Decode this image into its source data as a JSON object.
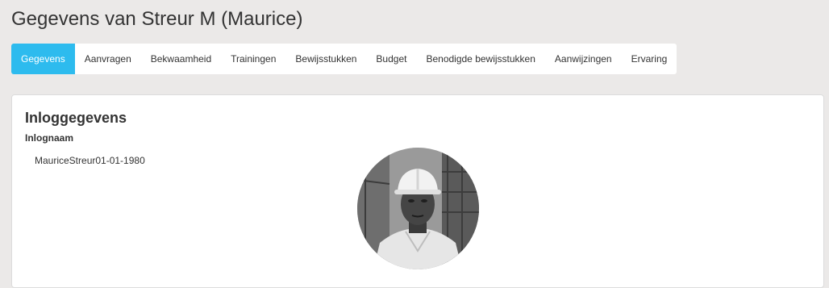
{
  "page": {
    "title": "Gegevens van Streur M (Maurice)"
  },
  "tabs": [
    {
      "label": "Gegevens",
      "active": true
    },
    {
      "label": "Aanvragen",
      "active": false
    },
    {
      "label": "Bekwaamheid",
      "active": false
    },
    {
      "label": "Trainingen",
      "active": false
    },
    {
      "label": "Bewijsstukken",
      "active": false
    },
    {
      "label": "Budget",
      "active": false
    },
    {
      "label": "Benodigde bewijsstukken",
      "active": false
    },
    {
      "label": "Aanwijzingen",
      "active": false
    },
    {
      "label": "Ervaring",
      "active": false
    }
  ],
  "login_section": {
    "title": "Inloggegevens",
    "username_label": "Inlognaam",
    "username_value": "MauriceStreur01-01-1980"
  },
  "colors": {
    "accent": "#2dbbee",
    "background": "#ebe9e8"
  }
}
